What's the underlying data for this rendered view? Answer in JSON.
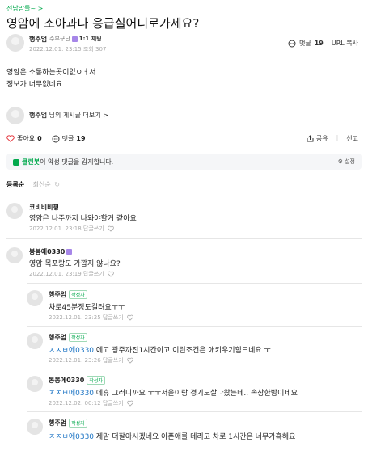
{
  "board": "전남맘들~ >",
  "title": "영암에 소아과나 응급실어디로가세요?",
  "post": {
    "author": "행주엄",
    "grade": "주부구단",
    "chat_label": "1:1 채팅",
    "date": "2022.12.01. 23:15 조회 307",
    "comment_label": "댓글",
    "comment_count": "19",
    "url_copy": "URL 복사",
    "lines": [
      "영암은 소통하는곳이없ㅇㅓ서",
      "정보가 너무없네요"
    ],
    "author_more": "님의 게시글 더보기 >",
    "author_short": "행주엄"
  },
  "actions": {
    "like_label": "좋아요",
    "like_count": "0",
    "comment_label": "댓글",
    "comment_count": "19",
    "share": "공유",
    "report": "신고"
  },
  "cleanbot": {
    "brand": "클린봇",
    "text": "이 악성 댓글을 감지합니다.",
    "setting": "설정"
  },
  "sort": {
    "active": "등록순",
    "inactive": "최신순"
  },
  "comments": [
    {
      "name": "코비비비핑",
      "text": "영암은 나주까지 나와야할거 같아요",
      "meta": "2022.12.01. 23:18 답글쓰기"
    },
    {
      "name": "봉봉에0330",
      "text": "영암 목포랑도 가깝지 않나요?",
      "meta": "2022.12.01. 23:19 답글쓰기"
    },
    {
      "name": "행주엄",
      "badge": "작성자",
      "text": "차로45분정도걸려요ㅜㅜ",
      "meta": "2022.12.01. 23:25 답글쓰기"
    },
    {
      "name": "행주엄",
      "badge": "작성자",
      "mention": "ㅈㅈㅂ에0330",
      "text": "에고 광주까진1시간이고 이런조건은 애키우기힘드네요 ㅜ",
      "meta": "2022.12.01. 23:26 답글쓰기"
    },
    {
      "name": "봉봉에0330",
      "badge": "작성자",
      "mention": "ㅈㅈㅂ에0330",
      "text": "에휴 그러니까요 ㅜㅜ서울이랑 경기도살다왔는데.. 속상한밤이네요",
      "meta": "2022.12.02. 00:12 답글쓰기"
    },
    {
      "name": "행주엄",
      "badge": "작성자",
      "mention": "ㅈㅈㅂ에0330",
      "text": "제맘 더잘아시겠네요 아픈애를 데리고 차로 1시간은 너무가혹해요",
      "meta": ""
    }
  ]
}
